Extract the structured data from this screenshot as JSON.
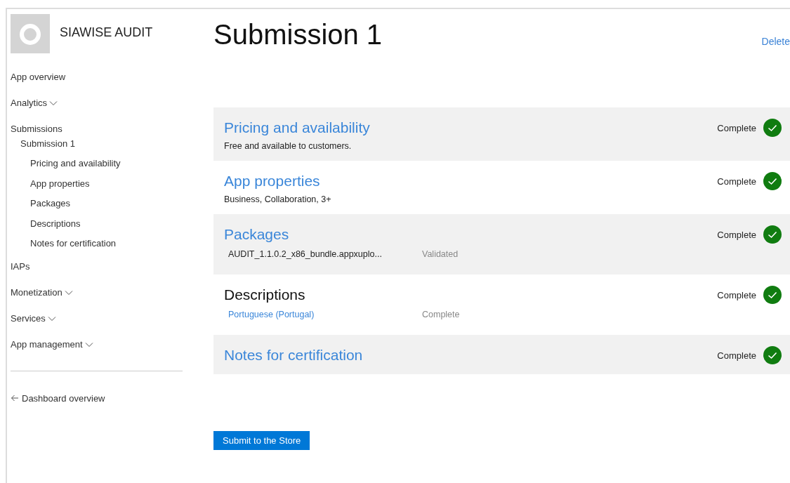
{
  "app": {
    "name": "SIAWISE AUDIT"
  },
  "nav": [
    {
      "label": "App overview",
      "kind": "link"
    },
    {
      "label": "Analytics",
      "kind": "expandable"
    },
    {
      "label": "Submissions",
      "kind": "link",
      "children": [
        {
          "label": "Submission 1",
          "children": [
            {
              "label": "Pricing and availability"
            },
            {
              "label": "App properties"
            },
            {
              "label": "Packages"
            },
            {
              "label": "Descriptions"
            },
            {
              "label": "Notes for certification"
            }
          ]
        }
      ]
    },
    {
      "label": "IAPs",
      "kind": "link"
    },
    {
      "label": "Monetization",
      "kind": "expandable"
    },
    {
      "label": "Services",
      "kind": "expandable"
    },
    {
      "label": "App management",
      "kind": "expandable"
    }
  ],
  "back_link": "Dashboard overview",
  "page_title": "Submission 1",
  "delete_link": "Delete",
  "sections": [
    {
      "title": "Pricing and availability",
      "title_link": true,
      "status": "Complete",
      "complete": true,
      "summary": "Free and available to customers."
    },
    {
      "title": "App properties",
      "title_link": true,
      "status": "Complete",
      "complete": true,
      "summary": "Business, Collaboration, 3+"
    },
    {
      "title": "Packages",
      "title_link": true,
      "status": "Complete",
      "complete": true,
      "items": [
        {
          "name": "AUDIT_1.1.0.2_x86_bundle.appxuplo...",
          "name_link": false,
          "status": "Validated"
        }
      ]
    },
    {
      "title": "Descriptions",
      "title_link": false,
      "status": "Complete",
      "complete": true,
      "items": [
        {
          "name": "Portuguese (Portugal)",
          "name_link": true,
          "status": "Complete"
        }
      ]
    },
    {
      "title": "Notes for certification",
      "title_link": true,
      "status": "Complete",
      "complete": true
    }
  ],
  "submit_button": "Submit to the Store"
}
